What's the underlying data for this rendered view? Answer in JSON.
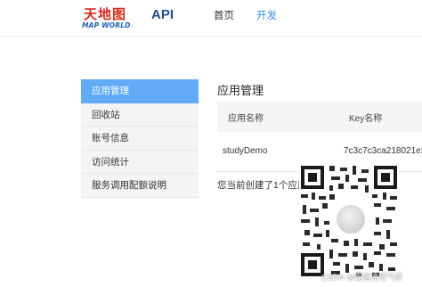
{
  "header": {
    "logo_text": "天地图",
    "logo_sub": "MAP WORLD",
    "api_label": "API",
    "nav": [
      {
        "label": "首页",
        "active": false
      },
      {
        "label": "开发",
        "active": true
      }
    ]
  },
  "sidebar": {
    "items": [
      {
        "label": "应用管理",
        "active": true
      },
      {
        "label": "回收站",
        "active": false
      },
      {
        "label": "账号信息",
        "active": false
      },
      {
        "label": "访问统计",
        "active": false
      },
      {
        "label": "服务调用配额说明",
        "active": false
      }
    ]
  },
  "main": {
    "title": "应用管理",
    "table": {
      "headers": [
        "应用名称",
        "Key名称"
      ],
      "rows": [
        {
          "name": "studyDemo",
          "key": "7c3c7c3ca218021e2"
        }
      ]
    },
    "summary": "您当前创建了1个应用"
  },
  "watermark": "CSDN @霸道流氓气质",
  "colors": {
    "accent": "#2f8ff0",
    "sidebar_active": "#60aaf6",
    "logo_red": "#d42a1c",
    "logo_blue": "#1d5fb4",
    "api_blue": "#1f4f87"
  }
}
